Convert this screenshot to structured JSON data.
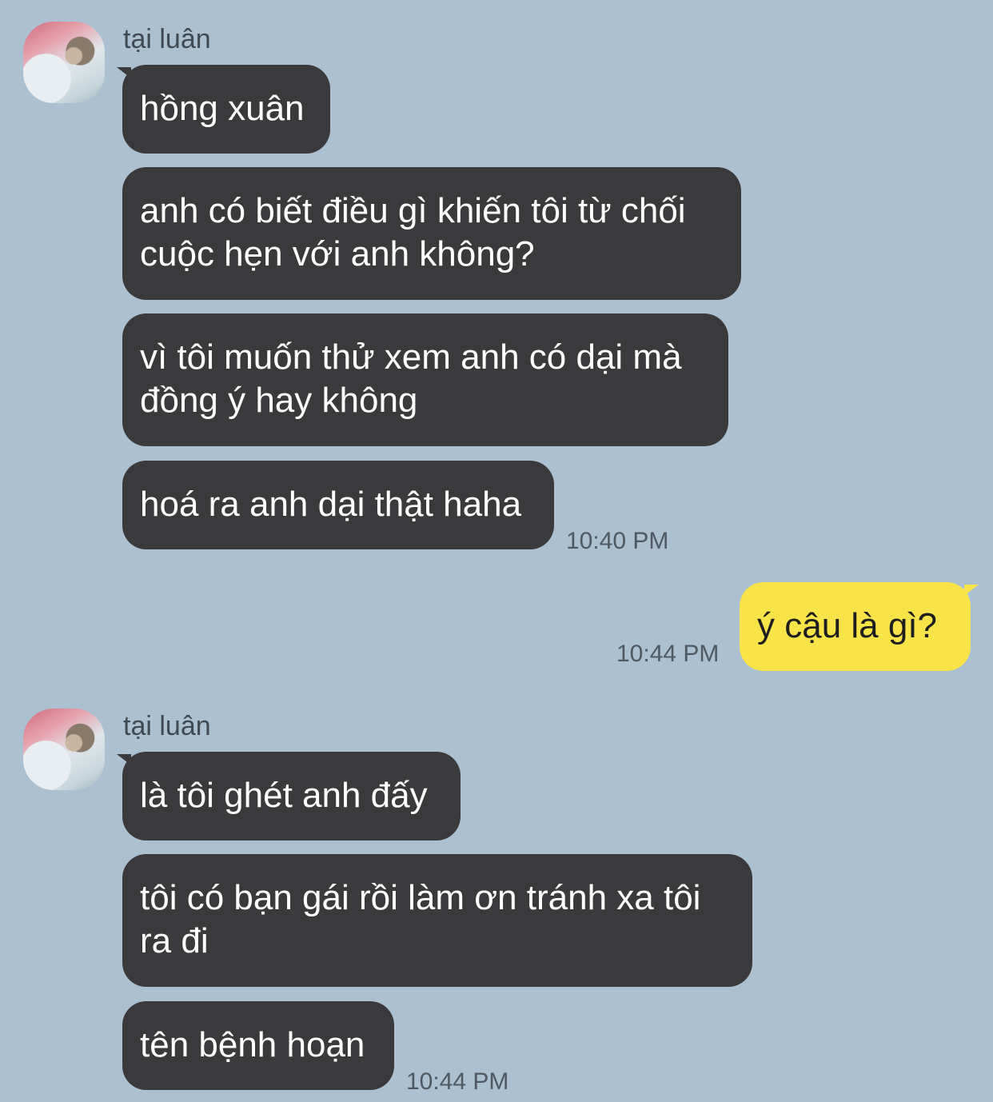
{
  "groups": [
    {
      "sender": "tại luân",
      "messages": [
        "hồng xuân",
        "anh có biết điều gì khiến tôi từ chối\ncuộc hẹn với anh không?",
        "vì tôi muốn thử xem anh có dại mà\nđồng ý hay không",
        "hoá ra anh dại thật haha"
      ],
      "time": "10:40 PM"
    },
    {
      "sender": "me",
      "messages": [
        "ý cậu là gì?"
      ],
      "time": "10:44 PM"
    },
    {
      "sender": "tại luân",
      "messages": [
        "là tôi ghét anh đấy",
        "tôi có bạn gái rồi làm ơn tránh xa tôi\nra đi",
        "tên bệnh hoạn"
      ],
      "time": "10:44 PM"
    }
  ],
  "colors": {
    "background": "#abc0d1",
    "incoming_bubble": "#3a3a3c",
    "outgoing_bubble": "#f8e448"
  },
  "icons": {
    "avatar": "contact-avatar-photo"
  }
}
